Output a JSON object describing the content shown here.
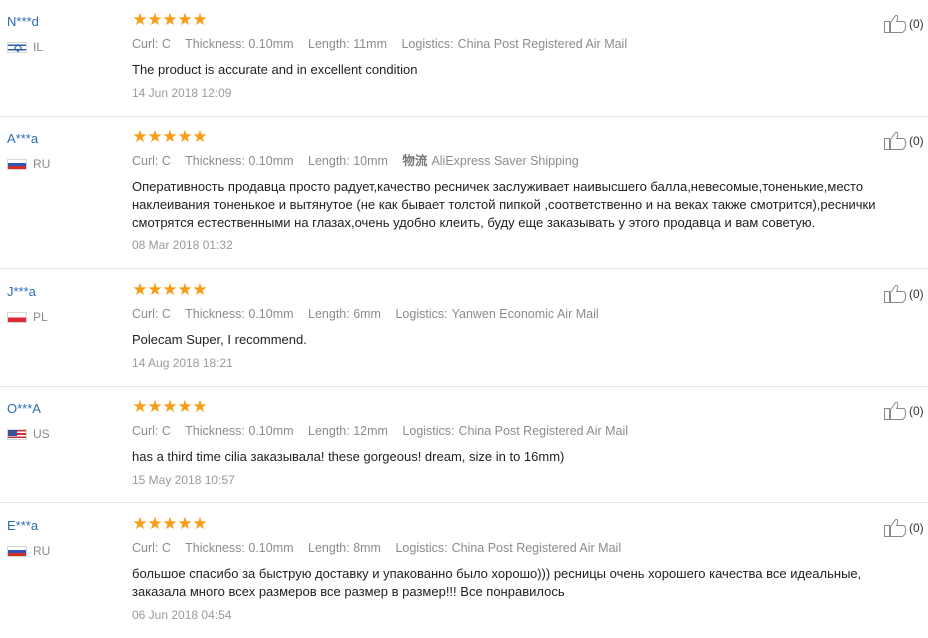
{
  "reviews": [
    {
      "user": "N***d",
      "country_code": "IL",
      "flag": "flag-il",
      "rating": 5,
      "curl": "Curl: C",
      "thickness": "Thickness: 0.10mm",
      "length": "Length: 11mm",
      "logistics_label": "Logistics:",
      "logistics_value": "China Post Registered Air Mail",
      "text": "The product is accurate and in excellent condition",
      "date": "14 Jun 2018 12:09",
      "useful_count": "(0)"
    },
    {
      "user": "A***a",
      "country_code": "RU",
      "flag": "flag-ru",
      "rating": 5,
      "curl": "Curl: C",
      "thickness": "Thickness: 0.10mm",
      "length": "Length: 10mm",
      "logistics_label": "物流",
      "logistics_value": "AliExpress Saver Shipping",
      "text": "Оперативность продавца просто радует,качество ресничек заслуживает наивысшего балла,невесомые,тоненькие,место наклеивания тоненькое и вытянутое (не как бывает толстой пипкой ,соответственно и на веках также смотрится),реснички смотрятся естественными на глазах,очень удобно клеить, буду еще заказывать у этого продавца и вам советую.",
      "date": "08 Mar 2018 01:32",
      "useful_count": "(0)"
    },
    {
      "user": "J***a",
      "country_code": "PL",
      "flag": "flag-pl",
      "rating": 5,
      "curl": "Curl: C",
      "thickness": "Thickness: 0.10mm",
      "length": "Length: 6mm",
      "logistics_label": "Logistics:",
      "logistics_value": "Yanwen Economic Air Mail",
      "text": "Polecam Super, I recommend.",
      "date": "14 Aug 2018 18:21",
      "useful_count": "(0)"
    },
    {
      "user": "O***A",
      "country_code": "US",
      "flag": "flag-us",
      "rating": 5,
      "curl": "Curl: C",
      "thickness": "Thickness: 0.10mm",
      "length": "Length: 12mm",
      "logistics_label": "Logistics:",
      "logistics_value": "China Post Registered Air Mail",
      "text": "has a third time cilia заказывала! these gorgeous! dream, size in to 16mm)",
      "date": "15 May 2018 10:57",
      "useful_count": "(0)"
    },
    {
      "user": "E***a",
      "country_code": "RU",
      "flag": "flag-ru",
      "rating": 5,
      "curl": "Curl: C",
      "thickness": "Thickness: 0.10mm",
      "length": "Length: 8mm",
      "logistics_label": "Logistics:",
      "logistics_value": "China Post Registered Air Mail",
      "text": "большое спасибо за быструю доставку и упакованно было хорошо))) ресницы очень хорошего качества все идеальные, заказала много всех размеров все размер в размер!!! Все понравилось",
      "date": "06 Jun 2018 04:54",
      "useful_count": "(0)"
    }
  ],
  "colors": {
    "star": "#f79d14",
    "username": "#2b6bb5",
    "meta": "#8c8c8c"
  },
  "icons": {
    "rating": "star-icon",
    "useful": "thumbs-up-icon"
  }
}
